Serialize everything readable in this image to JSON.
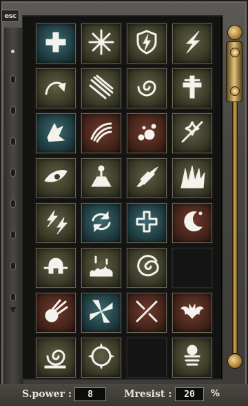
{
  "window": {
    "close_label": "esc"
  },
  "skills": [
    {
      "icon": "heal-cross-icon",
      "tint": "teal"
    },
    {
      "icon": "starburst-icon",
      "tint": "olive"
    },
    {
      "icon": "shield-lightning-icon",
      "tint": "olive"
    },
    {
      "icon": "lightning-bolt-icon",
      "tint": "olive"
    },
    {
      "icon": "curved-arrow-icon",
      "tint": "olive"
    },
    {
      "icon": "claw-slash-icon",
      "tint": "olive"
    },
    {
      "icon": "vortex-icon",
      "tint": "olive"
    },
    {
      "icon": "holy-cross-icon",
      "tint": "olive"
    },
    {
      "icon": "ice-shard-icon",
      "tint": "teal"
    },
    {
      "icon": "wing-icon",
      "tint": "rust"
    },
    {
      "icon": "poison-splat-icon",
      "tint": "rust"
    },
    {
      "icon": "sparkle-beam-icon",
      "tint": "olive"
    },
    {
      "icon": "evil-eye-icon",
      "tint": "olive"
    },
    {
      "icon": "altar-icon",
      "tint": "olive"
    },
    {
      "icon": "flame-swipe-icon",
      "tint": "olive"
    },
    {
      "icon": "spike-burst-icon",
      "tint": "olive"
    },
    {
      "icon": "twin-lightning-icon",
      "tint": "olive"
    },
    {
      "icon": "cycle-arrows-icon",
      "tint": "teal"
    },
    {
      "icon": "outline-cross-icon",
      "tint": "teal"
    },
    {
      "icon": "crescent-moon-icon",
      "tint": "rust"
    },
    {
      "icon": "helmet-icon",
      "tint": "olive"
    },
    {
      "icon": "aura-ground-icon",
      "tint": "olive"
    },
    {
      "icon": "spiral-wind-icon",
      "tint": "olive"
    },
    {
      "icon": "empty",
      "tint": "empty"
    },
    {
      "icon": "comet-icon",
      "tint": "rust"
    },
    {
      "icon": "shuriken-icon",
      "tint": "teal"
    },
    {
      "icon": "crossed-swords-icon",
      "tint": "rust"
    },
    {
      "icon": "bat-wings-icon",
      "tint": "rust"
    },
    {
      "icon": "snail-shell-icon",
      "tint": "olive"
    },
    {
      "icon": "thorn-ring-icon",
      "tint": "olive"
    },
    {
      "icon": "empty",
      "tint": "empty"
    },
    {
      "icon": "orb-pillar-icon",
      "tint": "olive"
    }
  ],
  "stats": {
    "spower_label": "S.power :",
    "spower_value": "8",
    "mresist_label": "Mresist :",
    "mresist_value": "20",
    "mresist_unit": "%"
  },
  "colors": {
    "teal": "#2f5a5e",
    "olive": "#4a4a34",
    "rust": "#5a2e22",
    "gold": "#c9a552"
  }
}
